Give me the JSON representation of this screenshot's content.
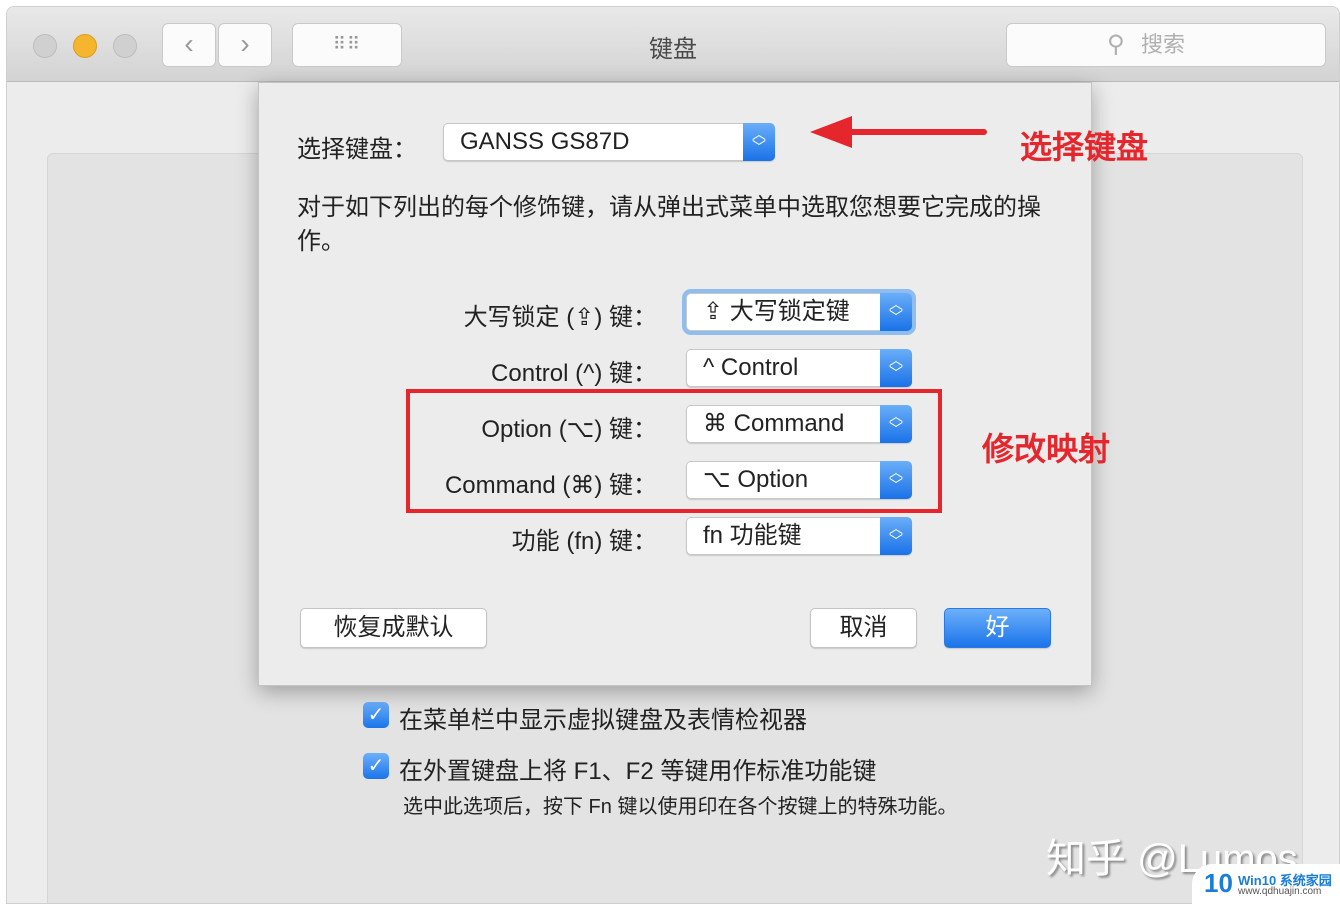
{
  "window": {
    "title": "键盘",
    "search_placeholder": "搜索"
  },
  "sheet": {
    "keyboard_label": "选择键盘：",
    "keyboard_value": "GANSS  GS87D",
    "description": "对于如下列出的每个修饰键，请从弹出式菜单中选取您想要它完成的操作。",
    "rows": [
      {
        "label": "大写锁定 (⇪) 键：",
        "value": "⇪ 大写锁定键"
      },
      {
        "label": "Control (^) 键：",
        "value": "^ Control"
      },
      {
        "label": "Option (⌥) 键：",
        "value": "⌘ Command"
      },
      {
        "label": "Command (⌘) 键：",
        "value": "⌥ Option"
      },
      {
        "label": "功能 (fn) 键：",
        "value": "fn 功能键"
      }
    ],
    "restore_label": "恢复成默认",
    "cancel_label": "取消",
    "ok_label": "好"
  },
  "settings": {
    "show_viewer": {
      "label": "在菜单栏中显示虚拟键盘及表情检视器",
      "checked": true
    },
    "fn_keys": {
      "label": "在外置键盘上将 F1、F2 等键用作标准功能键",
      "checked": true,
      "note": "选中此选项后，按下 Fn 键以使用印在各个按键上的特殊功能。"
    }
  },
  "annotations": {
    "select_keyboard": "选择键盘",
    "modify_mapping": "修改映射",
    "color": "#e5262c"
  },
  "watermark": {
    "text": "知乎 @Lumos",
    "badge": "Win10 系统家园",
    "badge_url": "www.qdhuajin.com"
  }
}
